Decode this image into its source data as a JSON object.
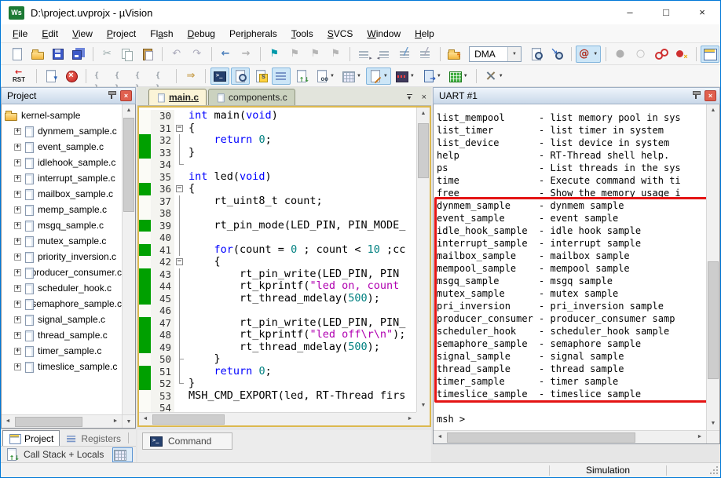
{
  "window": {
    "title": "D:\\project.uvprojx - µVision",
    "logo_text": "Ws",
    "controls": {
      "minimize": "–",
      "maximize": "□",
      "close": "×"
    }
  },
  "colors": {
    "accent_blue": "#0078d7",
    "coverage_green": "#00a000",
    "annotation_red": "#e41414",
    "keyword_blue": "#0000ff",
    "string_magenta": "#b000b0",
    "number_teal": "#008080",
    "editor_frame_gold": "#dcb84e"
  },
  "menu": {
    "items": [
      {
        "label": "File",
        "accel": 0
      },
      {
        "label": "Edit",
        "accel": 0
      },
      {
        "label": "View",
        "accel": 0
      },
      {
        "label": "Project",
        "accel": 0
      },
      {
        "label": "Flash",
        "accel": 2
      },
      {
        "label": "Debug",
        "accel": 0
      },
      {
        "label": "Peripherals",
        "accel": 3
      },
      {
        "label": "Tools",
        "accel": 0
      },
      {
        "label": "SVCS",
        "accel": 0
      },
      {
        "label": "Window",
        "accel": 0
      },
      {
        "label": "Help",
        "accel": 0
      }
    ]
  },
  "toolbar1": [
    {
      "n": "new-file-icon",
      "k": "page"
    },
    {
      "n": "open-file-icon",
      "k": "folder"
    },
    {
      "n": "save-icon",
      "k": "floppy"
    },
    {
      "n": "save-all-icon",
      "k": "floppy2"
    },
    {
      "sep": true
    },
    {
      "n": "cut-icon",
      "g": "✂",
      "c": "#9aa"
    },
    {
      "n": "copy-icon",
      "k": "copy"
    },
    {
      "n": "paste-icon",
      "k": "paste"
    },
    {
      "sep": true
    },
    {
      "n": "undo-icon",
      "g": "↶",
      "c": "#aab"
    },
    {
      "n": "redo-icon",
      "g": "↷",
      "c": "#aab"
    },
    {
      "sep": true
    },
    {
      "n": "navigate-back-icon",
      "g": "←",
      "c": "#4a7ebb",
      "b": 1
    },
    {
      "n": "navigate-forward-icon",
      "g": "→",
      "c": "#b0b0b0",
      "b": 1
    },
    {
      "sep": true
    },
    {
      "n": "bookmark-toggle-icon",
      "g": "⚑",
      "c": "#0099aa"
    },
    {
      "n": "bookmark-next-icon",
      "g": "⚑",
      "c": "#b5b5b5"
    },
    {
      "n": "bookmark-prev-icon",
      "g": "⚑",
      "c": "#b5b5b5"
    },
    {
      "n": "bookmark-clear-icon",
      "g": "⚑",
      "c": "#b5b5b5"
    },
    {
      "sep": true
    },
    {
      "n": "indent-icon",
      "k": "lines-r"
    },
    {
      "n": "outdent-icon",
      "k": "lines-l"
    },
    {
      "n": "comment-icon",
      "k": "comment"
    },
    {
      "n": "uncomment-icon",
      "k": "comment2"
    },
    {
      "sep": true
    },
    {
      "n": "flash-options-icon",
      "k": "folder-flash"
    },
    {
      "combo": "DMA"
    },
    {
      "n": "find-in-files-icon",
      "k": "page-mag"
    },
    {
      "n": "incremental-find-icon",
      "k": "mag-arrow"
    },
    {
      "sep": true
    },
    {
      "n": "symbol-search-icon",
      "k": "at",
      "hl": 1,
      "caret": 1
    },
    {
      "sep": true
    },
    {
      "n": "breakpoint-insert-icon",
      "g": "●",
      "c": "#b0b0b0"
    },
    {
      "n": "breakpoint-enable-icon",
      "g": "○",
      "c": "#b8b8b8"
    },
    {
      "n": "breakpoint-kill-all-icon",
      "k": "bp-kill"
    },
    {
      "n": "breakpoint-clear-all-icon",
      "k": "bp-clear"
    },
    {
      "sep": true
    },
    {
      "n": "window-layout-icon",
      "k": "win",
      "hl": 1
    }
  ],
  "toolbar2": [
    {
      "n": "reset-cpu-icon",
      "k": "rst"
    },
    {
      "sep": true
    },
    {
      "n": "run-icon",
      "k": "page-arrow"
    },
    {
      "n": "stop-icon",
      "k": "stop"
    },
    {
      "sep": true
    },
    {
      "n": "step-into-icon",
      "k": "braces"
    },
    {
      "n": "step-over-icon",
      "k": "braces"
    },
    {
      "n": "step-out-icon",
      "k": "braces"
    },
    {
      "n": "run-to-cursor-icon",
      "k": "braces"
    },
    {
      "sep": true
    },
    {
      "n": "show-next-statement-icon",
      "g": "⇒",
      "c": "#c8a050",
      "b": 1
    },
    {
      "sep": true
    },
    {
      "n": "command-window-icon",
      "k": "term",
      "hl": 1
    },
    {
      "n": "disassembly-window-icon",
      "k": "page-mag",
      "hl": 1
    },
    {
      "n": "symbol-window-icon",
      "k": "symS"
    },
    {
      "n": "registers-window-icon",
      "k": "lines-blue",
      "hl": 1
    },
    {
      "n": "call-stack-window-icon",
      "k": "pages-arrow"
    },
    {
      "n": "watch-window-icon",
      "k": "watch",
      "caret": 1
    },
    {
      "n": "memory-window-icon",
      "k": "grid-gray",
      "caret": 1
    },
    {
      "n": "serial-window-icon",
      "k": "page-pen",
      "hl": 1,
      "caret": 1
    },
    {
      "n": "logic-analyzer-icon",
      "k": "wave",
      "caret": 1
    },
    {
      "n": "system-viewer-icon",
      "k": "page-blue",
      "caret": 1
    },
    {
      "n": "toolbox-icon",
      "k": "grid-green",
      "caret": 1
    },
    {
      "sep": true
    },
    {
      "n": "debug-tools-icon",
      "k": "tools",
      "caret": 1
    }
  ],
  "project_panel": {
    "title": "Project",
    "root": "kernel-sample",
    "files": [
      "dynmem_sample.c",
      "event_sample.c",
      "idlehook_sample.c",
      "interrupt_sample.c",
      "mailbox_sample.c",
      "memp_sample.c",
      "msgq_sample.c",
      "mutex_sample.c",
      "priority_inversion.c",
      "producer_consumer.c",
      "scheduler_hook.c",
      "semaphore_sample.c",
      "signal_sample.c",
      "thread_sample.c",
      "timer_sample.c",
      "timeslice_sample.c"
    ]
  },
  "panel_tabs": {
    "project": "Project",
    "registers": "Registers"
  },
  "callstack_bar": {
    "label": "Call Stack + Locals"
  },
  "command_tab": {
    "label": "Command"
  },
  "editor": {
    "tabs": [
      {
        "label": "main.c",
        "active": true
      },
      {
        "label": "components.c",
        "active": false
      }
    ],
    "lines": [
      {
        "n": 30,
        "f": "",
        "cov": false,
        "t": [
          [
            "int",
            "k"
          ],
          [
            " main(",
            "p"
          ],
          [
            "void",
            "k"
          ],
          [
            ")",
            "p"
          ]
        ]
      },
      {
        "n": 31,
        "f": "m",
        "cov": false,
        "t": [
          [
            "{",
            "p"
          ]
        ]
      },
      {
        "n": 32,
        "f": "v",
        "cov": true,
        "t": [
          [
            "    ",
            "p"
          ],
          [
            "return",
            "k"
          ],
          [
            " ",
            "p"
          ],
          [
            "0",
            "n"
          ],
          [
            ";",
            "p"
          ]
        ]
      },
      {
        "n": 33,
        "f": "v",
        "cov": true,
        "t": [
          [
            "}",
            "p"
          ]
        ]
      },
      {
        "n": 34,
        "f": "e",
        "cov": false,
        "t": []
      },
      {
        "n": 35,
        "f": "",
        "cov": false,
        "t": [
          [
            "int",
            "k"
          ],
          [
            " led(",
            "p"
          ],
          [
            "void",
            "k"
          ],
          [
            ")",
            "p"
          ]
        ]
      },
      {
        "n": 36,
        "f": "m",
        "cov": true,
        "t": [
          [
            "{",
            "p"
          ]
        ]
      },
      {
        "n": 37,
        "f": "v",
        "cov": false,
        "t": [
          [
            "    rt_uint8_t count;",
            "p"
          ]
        ]
      },
      {
        "n": 38,
        "f": "v",
        "cov": false,
        "t": []
      },
      {
        "n": 39,
        "f": "v",
        "cov": true,
        "t": [
          [
            "    rt_pin_mode(LED_PIN, PIN_MODE_",
            "p"
          ]
        ]
      },
      {
        "n": 40,
        "f": "v",
        "cov": false,
        "t": []
      },
      {
        "n": 41,
        "f": "v",
        "cov": true,
        "t": [
          [
            "    ",
            "p"
          ],
          [
            "for",
            "k"
          ],
          [
            "(count = ",
            "p"
          ],
          [
            "0",
            "n"
          ],
          [
            " ; count < ",
            "p"
          ],
          [
            "10",
            "n"
          ],
          [
            " ;cc",
            "p"
          ]
        ]
      },
      {
        "n": 42,
        "f": "m",
        "cov": false,
        "t": [
          [
            "    {",
            "p"
          ]
        ]
      },
      {
        "n": 43,
        "f": "v",
        "cov": true,
        "t": [
          [
            "        rt_pin_write(LED_PIN, PIN",
            "p"
          ]
        ]
      },
      {
        "n": 44,
        "f": "v",
        "cov": true,
        "t": [
          [
            "        rt_kprintf(",
            "p"
          ],
          [
            "\"led on, count",
            "s"
          ]
        ]
      },
      {
        "n": 45,
        "f": "v",
        "cov": true,
        "t": [
          [
            "        rt_thread_mdelay(",
            "p"
          ],
          [
            "500",
            "n"
          ],
          [
            ");",
            "p"
          ]
        ]
      },
      {
        "n": 46,
        "f": "v",
        "cov": false,
        "t": []
      },
      {
        "n": 47,
        "f": "v",
        "cov": true,
        "t": [
          [
            "        rt_pin_write(LED_PIN, PIN_",
            "p"
          ]
        ]
      },
      {
        "n": 48,
        "f": "v",
        "cov": true,
        "t": [
          [
            "        rt_kprintf(",
            "p"
          ],
          [
            "\"led off\\r\\n\"",
            "s"
          ],
          [
            ");",
            "p"
          ]
        ]
      },
      {
        "n": 49,
        "f": "v",
        "cov": true,
        "t": [
          [
            "        rt_thread_mdelay(",
            "p"
          ],
          [
            "500",
            "n"
          ],
          [
            ");",
            "p"
          ]
        ]
      },
      {
        "n": 50,
        "f": "t",
        "cov": false,
        "t": [
          [
            "    }",
            "p"
          ]
        ]
      },
      {
        "n": 51,
        "f": "v",
        "cov": true,
        "t": [
          [
            "    ",
            "p"
          ],
          [
            "return",
            "k"
          ],
          [
            " ",
            "p"
          ],
          [
            "0",
            "n"
          ],
          [
            ";",
            "p"
          ]
        ]
      },
      {
        "n": 52,
        "f": "e",
        "cov": true,
        "t": [
          [
            "}",
            "p"
          ]
        ]
      },
      {
        "n": 53,
        "f": "",
        "cov": false,
        "t": [
          [
            "MSH_CMD_EXPORT(led, RT-Thread firs",
            "p"
          ]
        ]
      },
      {
        "n": 54,
        "f": "",
        "cov": false,
        "t": []
      }
    ]
  },
  "uart_panel": {
    "title": "UART #1",
    "lines": [
      "list_mempool      - list memory pool in sys",
      "list_timer        - list timer in system",
      "list_device       - list device in system",
      "help              - RT-Thread shell help.",
      "ps                - List threads in the sys",
      "time              - Execute command with ti",
      "free              - Show the memory usage i",
      "dynmem_sample     - dynmem sample",
      "event_sample      - event sample",
      "idle_hook_sample  - idle hook sample",
      "interrupt_sample  - interrupt sample",
      "mailbox_sample    - mailbox sample",
      "mempool_sample    - mempool sample",
      "msgq_sample       - msgq sample",
      "mutex_sample      - mutex sample",
      "pri_inversion     - pri_inversion sample",
      "producer_consumer - producer_consumer samp",
      "scheduler_hook    - scheduler_hook sample",
      "semaphore_sample  - semaphore sample",
      "signal_sample     - signal sample",
      "thread_sample     - thread sample",
      "timer_sample      - timer sample",
      "timeslice_sample  - timeslice sample",
      "",
      "msh >"
    ]
  },
  "status_bar": {
    "mode": "Simulation"
  }
}
